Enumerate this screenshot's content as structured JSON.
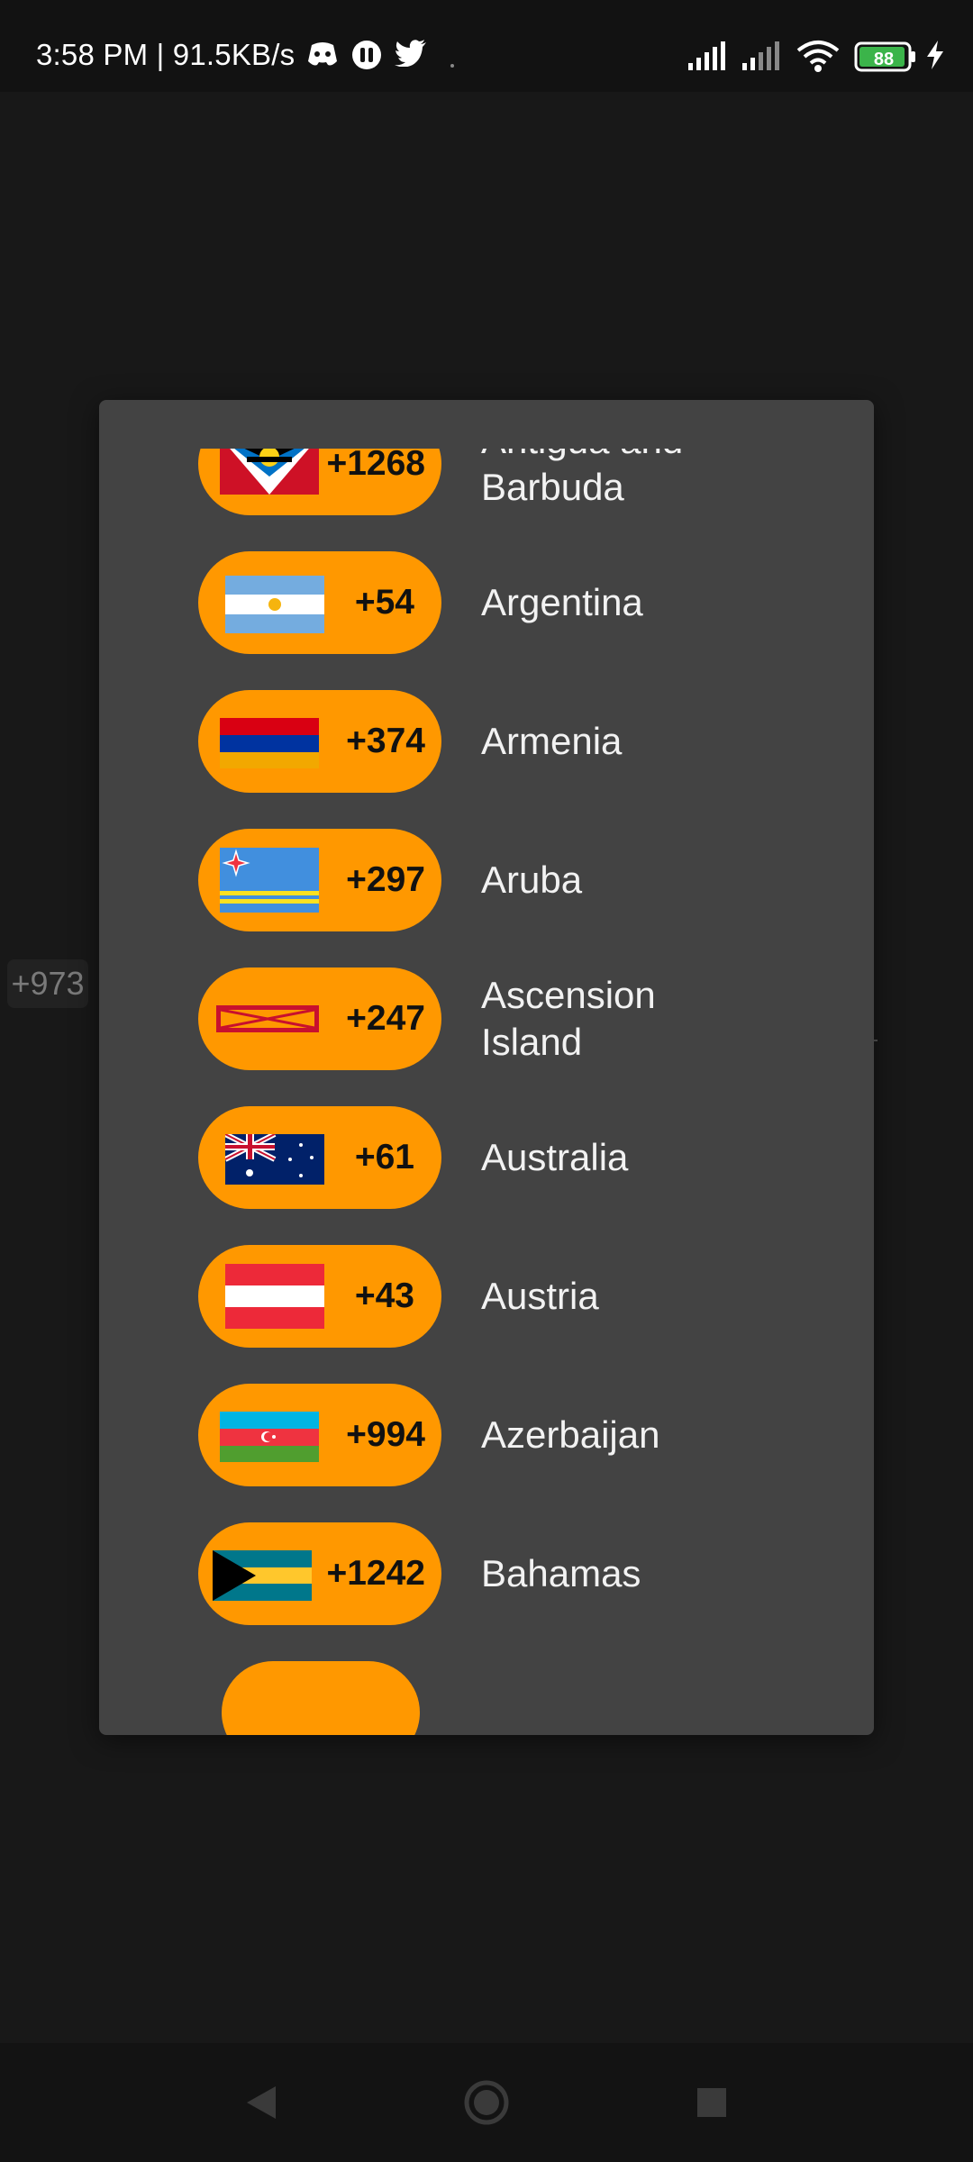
{
  "status_bar": {
    "time_speed": "3:58 PM | 91.5KB/s",
    "battery": "88",
    "icons_left": [
      "discord-icon",
      "mastodon-icon",
      "twitter-icon"
    ],
    "icons_right": [
      "signal-icon",
      "signal-icon",
      "wifi-icon",
      "battery-icon",
      "charging-icon"
    ]
  },
  "background": {
    "selected_code": "+973"
  },
  "dialog": {
    "countries": [
      {
        "code": "+1268",
        "name": "Antigua and Barbuda",
        "flag": "antigua-flag"
      },
      {
        "code": "+54",
        "name": "Argentina",
        "flag": "argentina-flag"
      },
      {
        "code": "+374",
        "name": "Armenia",
        "flag": "armenia-flag"
      },
      {
        "code": "+297",
        "name": "Aruba",
        "flag": "aruba-flag"
      },
      {
        "code": "+247",
        "name": "Ascension Island",
        "flag": "ascension-flag"
      },
      {
        "code": "+61",
        "name": "Australia",
        "flag": "australia-flag"
      },
      {
        "code": "+43",
        "name": "Austria",
        "flag": "austria-flag"
      },
      {
        "code": "+994",
        "name": "Azerbaijan",
        "flag": "azerbaijan-flag"
      },
      {
        "code": "+1242",
        "name": "Bahamas",
        "flag": "bahamas-flag"
      }
    ]
  },
  "nav_bar": {
    "buttons": [
      "back",
      "home",
      "recents"
    ]
  },
  "colors": {
    "pill": "#ff9800",
    "dialog": "#434343",
    "background": "#181818"
  }
}
